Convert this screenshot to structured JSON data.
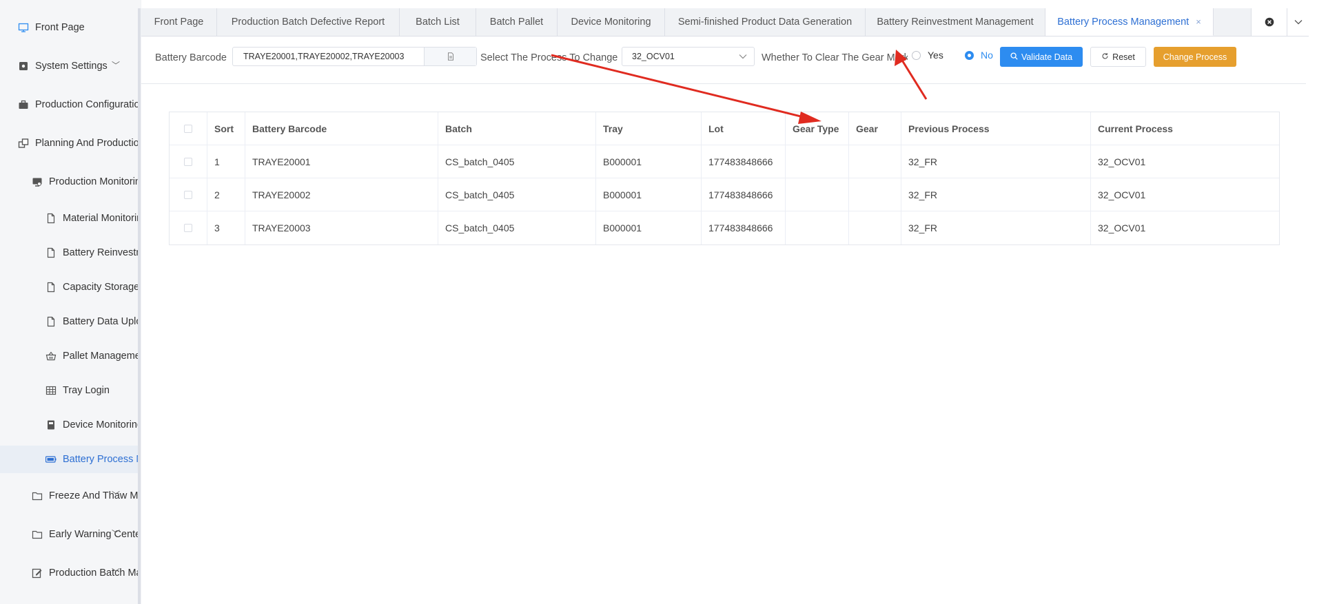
{
  "sidebar": {
    "items": [
      {
        "label": "Front Page",
        "icon": "monitor-icon"
      },
      {
        "label": "System Settings",
        "icon": "settings-box-icon"
      },
      {
        "label": "Production Configuration",
        "icon": "briefcase-icon"
      },
      {
        "label": "Planning And Production",
        "icon": "windows-icon"
      },
      {
        "label": "Production Monitoring",
        "icon": "monitor-settings-icon"
      },
      {
        "label": "Material Monitoring",
        "icon": "file-icon"
      },
      {
        "label": "Battery Reinvestment",
        "icon": "file-icon"
      },
      {
        "label": "Capacity Storage L",
        "icon": "file-icon"
      },
      {
        "label": "Battery Data Upload",
        "icon": "file-icon"
      },
      {
        "label": "Pallet Management",
        "icon": "basket-icon"
      },
      {
        "label": "Tray Login",
        "icon": "grid-icon"
      },
      {
        "label": "Device Monitoring",
        "icon": "device-icon"
      },
      {
        "label": "Battery Process M",
        "icon": "battery-icon"
      },
      {
        "label": "Freeze And Thaw Ma",
        "icon": "folder-icon"
      },
      {
        "label": "Early Warning Center",
        "icon": "folder-icon"
      },
      {
        "label": "Production Batch Man",
        "icon": "edit-icon"
      }
    ]
  },
  "tabs": [
    {
      "label": "Front Page"
    },
    {
      "label": "Production Batch Defective Report"
    },
    {
      "label": "Batch List"
    },
    {
      "label": "Batch Pallet"
    },
    {
      "label": "Device Monitoring"
    },
    {
      "label": "Semi-finished Product Data Generation"
    },
    {
      "label": "Battery Reinvestment Management"
    },
    {
      "label": "Battery Process Management",
      "close": "×"
    }
  ],
  "form": {
    "barcode_label": "Battery Barcode",
    "barcode_value": "TRAYE20001,TRAYE20002,TRAYE20003",
    "process_label": "Select The Process To Change",
    "process_value": "32_OCV01",
    "gear_label": "Whether To Clear The Gear Mark",
    "yes_label": "Yes",
    "no_label": "No",
    "selected": "No",
    "validate_label": "Validate Data",
    "reset_label": "Reset",
    "change_label": "Change Process"
  },
  "table": {
    "headers": [
      "Sort",
      "Battery Barcode",
      "Batch",
      "Tray",
      "Lot",
      "Gear Type",
      "Gear",
      "Previous Process",
      "Current Process"
    ],
    "rows": [
      [
        "1",
        "TRAYE20001",
        "CS_batch_0405",
        "B000001",
        "177483848666",
        "",
        "",
        "32_FR",
        "32_OCV01"
      ],
      [
        "2",
        "TRAYE20002",
        "CS_batch_0405",
        "B000001",
        "177483848666",
        "",
        "",
        "32_FR",
        "32_OCV01"
      ],
      [
        "3",
        "TRAYE20003",
        "CS_batch_0405",
        "B000001",
        "177483848666",
        "",
        "",
        "32_FR",
        "32_OCV01"
      ]
    ]
  },
  "colors": {
    "accent": "#2d8cf0",
    "warning": "#e69f2e",
    "active_tab": "#2d6fd3",
    "annotation": "#e02b20"
  }
}
